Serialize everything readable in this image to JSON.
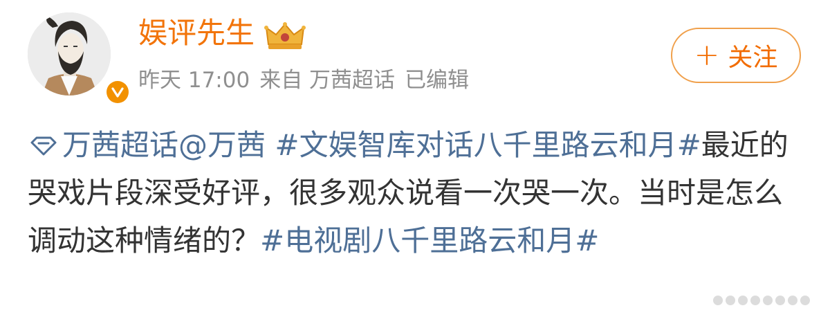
{
  "user": {
    "name": "娱评先生",
    "avatar": "avatar-illustration-bearded-man",
    "badge_icon": "crown-icon",
    "verified_icon": "verified-v-icon",
    "verified_label": "v"
  },
  "meta": {
    "time": "昨天 17:00",
    "source": "来自 万茜超话",
    "edited": "已编辑"
  },
  "follow_button": {
    "plus": "+",
    "label": "关注"
  },
  "post": {
    "supertopic_icon": "diamond-icon",
    "supertopic": "万茜超话",
    "mention": "@万茜",
    "hashtag1": "#文娱智库对话八千里路云和月#",
    "text1": "最近的哭戏片段深受好评，很多观众说看一次哭一次。当时是怎么调动这种情绪的？",
    "hashtag2": "#电视剧八千里路云和月#"
  },
  "colors": {
    "username": "#f2740a",
    "link": "#4e6f96",
    "body_text": "#333333",
    "meta_text": "#8f8f8f",
    "follow_border": "#f0a04b",
    "follow_text": "#f26c00",
    "verified": "#f29100"
  }
}
